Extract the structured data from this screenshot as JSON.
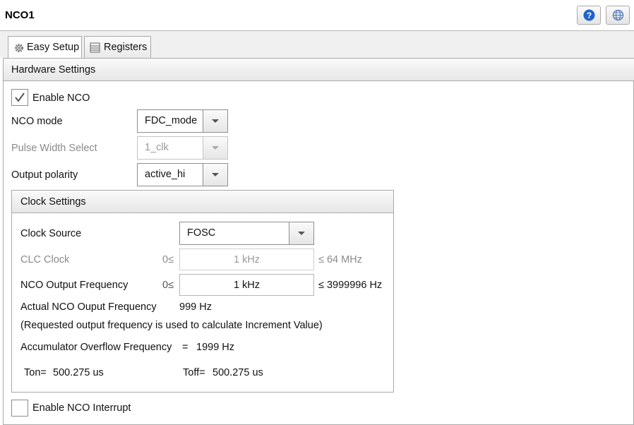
{
  "window": {
    "title": "NCO1"
  },
  "toolbar": {
    "help_icon": "help-icon",
    "globe_icon": "globe-icon"
  },
  "tabs": [
    {
      "label": "Easy Setup",
      "icon": "gear-icon",
      "active": true
    },
    {
      "label": "Registers",
      "icon": "register-list-icon",
      "active": false
    }
  ],
  "hardware": {
    "title": "Hardware Settings",
    "enable_nco": {
      "label": "Enable NCO",
      "checked": true
    },
    "nco_mode": {
      "label": "NCO mode",
      "value": "FDC_mode"
    },
    "pulse_width": {
      "label": "Pulse Width Select",
      "value": "1_clk",
      "disabled": true
    },
    "output_polarity": {
      "label": "Output polarity",
      "value": "active_hi"
    }
  },
  "clock": {
    "title": "Clock Settings",
    "source": {
      "label": "Clock Source",
      "value": "FOSC"
    },
    "clc_clock": {
      "label": "CLC Clock",
      "prefix": "0≤",
      "value": "1 kHz",
      "suffix": "≤ 64 MHz",
      "disabled": true
    },
    "nco_output_freq": {
      "label": "NCO Output Frequency",
      "prefix": "0≤",
      "value": "1 kHz",
      "suffix": "≤ 3999996 Hz"
    },
    "actual_freq": {
      "label": "Actual NCO Ouput Frequency",
      "value": "999 Hz"
    },
    "note": "(Requested output frequency is used to calculate Increment Value)",
    "overflow": {
      "label": "Accumulator Overflow Frequency",
      "eq": "=",
      "value": "1999 Hz"
    },
    "ton": {
      "label": "Ton=",
      "value": "500.275 us"
    },
    "toff": {
      "label": "Toff=",
      "value": "500.275 us"
    }
  },
  "interrupt": {
    "label": "Enable NCO Interrupt",
    "checked": false
  }
}
